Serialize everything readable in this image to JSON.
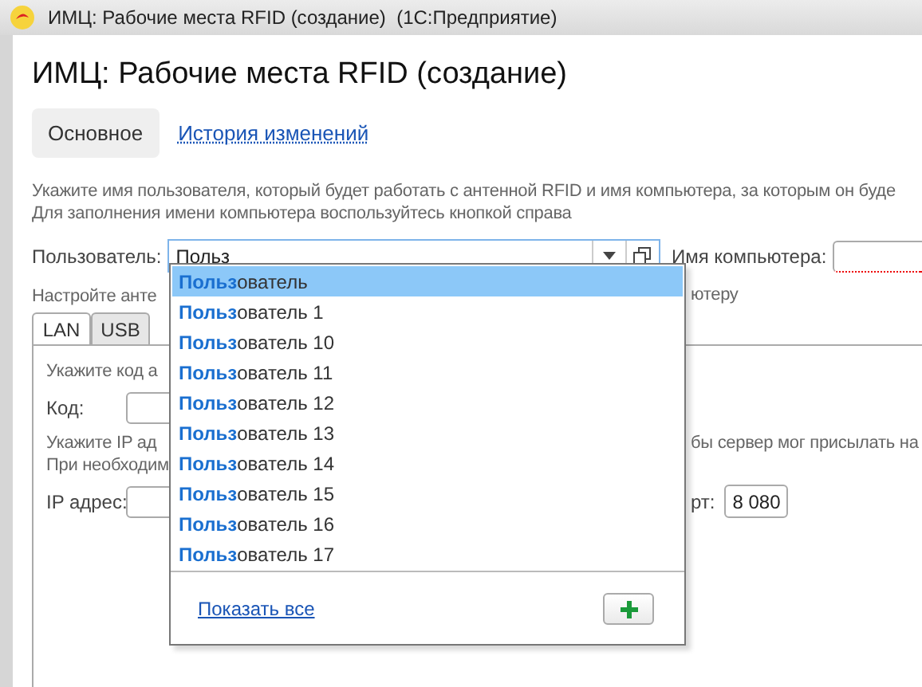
{
  "window": {
    "title": "ИМЦ: Рабочие места RFID (создание)  (1С:Предприятие)"
  },
  "form_title": "ИМЦ: Рабочие места RFID (создание)",
  "form_tabs": [
    {
      "label": "Основное",
      "selected": true
    },
    {
      "label": "История изменений",
      "selected": false
    }
  ],
  "hint_lines": [
    "Укажите имя пользователя, который будет работать с антенной RFID и имя компьютера, за которым он буде",
    "Для заполнения имени компьютера воспользуйтесь кнопкой справа"
  ],
  "user_field": {
    "label": "Пользователь:",
    "value": "Польз"
  },
  "computer_field": {
    "label": "Имя компьютера:"
  },
  "antenna_hint": {
    "left": "Настройте анте",
    "right": "ютеру"
  },
  "connection_tabs": [
    {
      "label": "LAN",
      "selected": true
    },
    {
      "label": "USB",
      "selected": false
    }
  ],
  "lan": {
    "code_hint": "Укажите код а",
    "code_label": "Код:",
    "ip_hint_left": "Укажите IP ад",
    "ip_hint_right": "бы сервер мог присылать на",
    "ip_hint_line2": "При необходим",
    "ip_label": "IP адрес:",
    "port_label": "рт:",
    "port_value": "8 080"
  },
  "dropdown": {
    "items": [
      {
        "text": "**Польз**ователь",
        "selected": true
      },
      {
        "text": "**Польз**ователь 1",
        "selected": false
      },
      {
        "text": "**Польз**ователь 10",
        "selected": false
      },
      {
        "text": "**Польз**ователь 11",
        "selected": false
      },
      {
        "text": "**Польз**ователь 12",
        "selected": false
      },
      {
        "text": "**Польз**ователь 13",
        "selected": false
      },
      {
        "text": "**Польз**ователь 14",
        "selected": false
      },
      {
        "text": "**Польз**ователь 15",
        "selected": false
      },
      {
        "text": "**Польз**ователь 16",
        "selected": false
      },
      {
        "text": "**Польз**ователь 17",
        "selected": false
      }
    ],
    "show_all": "Показать все"
  }
}
